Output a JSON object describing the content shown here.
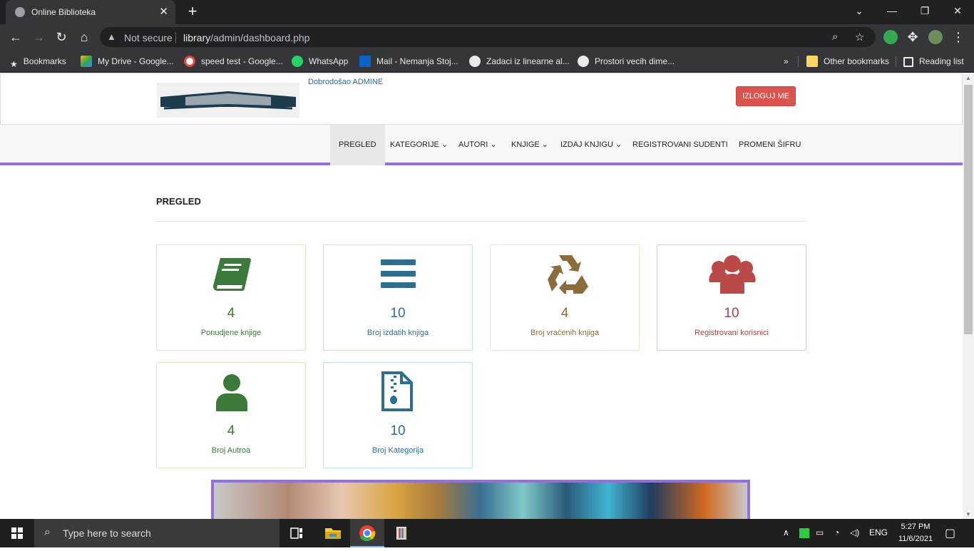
{
  "browser": {
    "tab_title": "Online Biblioteka",
    "not_secure": "Not secure",
    "url_host": "library",
    "url_path": "/admin/dashboard.php",
    "bookmarks": [
      {
        "label": "Bookmarks",
        "icon": "star-icon"
      },
      {
        "label": "My Drive - Google...",
        "icon": "drive-icon"
      },
      {
        "label": "speed test - Google...",
        "icon": "google-icon"
      },
      {
        "label": "WhatsApp",
        "icon": "whatsapp-icon"
      },
      {
        "label": "Mail - Nemanja Stoj...",
        "icon": "outlook-icon"
      },
      {
        "label": "Zadaci iz linearne al...",
        "icon": "globe-icon"
      },
      {
        "label": "Prostori vecih dime...",
        "icon": "globe-icon"
      }
    ],
    "more_bookmarks": "»",
    "other_bookmarks": "Other bookmarks",
    "reading_list": "Reading list"
  },
  "header": {
    "welcome": "Dobrodošao ADMINE",
    "logout_label": "IZLOGUJ ME"
  },
  "menu": [
    {
      "label": "PREGLED",
      "active": true
    },
    {
      "label": "KATEGORIJE",
      "dropdown": true
    },
    {
      "label": "AUTORI",
      "dropdown": true
    },
    {
      "label": "KNJIGE",
      "dropdown": true
    },
    {
      "label": "IZDAJ KNJIGU",
      "dropdown": true
    },
    {
      "label": "REGISTROVANI SUDENTI"
    },
    {
      "label": "PROMENI ŠIFRU"
    }
  ],
  "section_title": "PREGLED",
  "cards": [
    {
      "value": "4",
      "label": "Ponudjene knjige",
      "icon": "book-icon",
      "color": "#3c7a3b",
      "border": "#e3e1c4"
    },
    {
      "value": "10",
      "label": "Broj izdatih knjiga",
      "icon": "bars-icon",
      "color": "#2e6f8f",
      "border": "#bfe1ea"
    },
    {
      "value": "4",
      "label": "Broj vraćenih knjiga",
      "icon": "recycle-icon",
      "color": "#8a6d3b",
      "border": "#f6e3c7"
    },
    {
      "value": "10",
      "label": "Registrovani korisnici",
      "icon": "users-icon",
      "color": "#a94442",
      "border": "#e2c7c7"
    },
    {
      "value": "4",
      "label": "Broj Autroa",
      "icon": "user-icon",
      "color": "#3c7a3b",
      "border": "#e3e1c4"
    },
    {
      "value": "10",
      "label": "Broj Kategorija",
      "icon": "file-zipper-icon",
      "color": "#2e6f8f",
      "border": "#bfe1ea"
    }
  ],
  "taskbar": {
    "search_placeholder": "Type here to search",
    "lang": "ENG",
    "time": "5:27 PM",
    "date": "11/6/2021"
  },
  "colors": {
    "accent_purple": "#9370db",
    "logout_red": "#d9534f"
  }
}
